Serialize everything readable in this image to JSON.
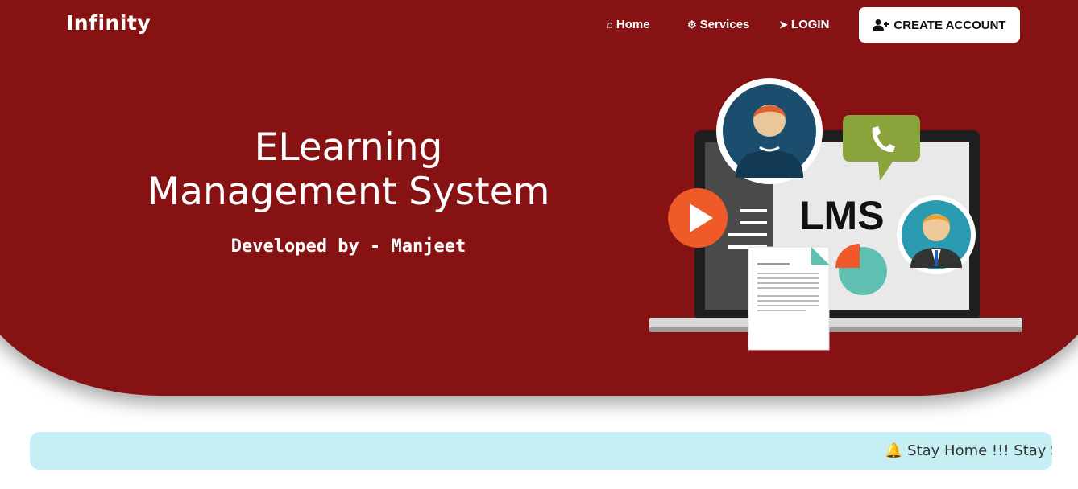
{
  "brand": "Infinity",
  "nav": {
    "home": "Home",
    "services": "Services",
    "login": "LOGIN",
    "create_account": "CREATE ACCOUNT"
  },
  "hero": {
    "title": "ELearning Management System",
    "subtitle": "Developed by - Manjeet"
  },
  "illustration": {
    "label": "LMS"
  },
  "ticker": {
    "text": "Stay Home !!! Stay Safe"
  },
  "colors": {
    "hero_bg": "#861213",
    "ticker_bg": "#c5eff3"
  },
  "icons": [
    "home-icon",
    "gear-icon",
    "sign-in-icon",
    "user-plus-icon",
    "bell-icon"
  ]
}
